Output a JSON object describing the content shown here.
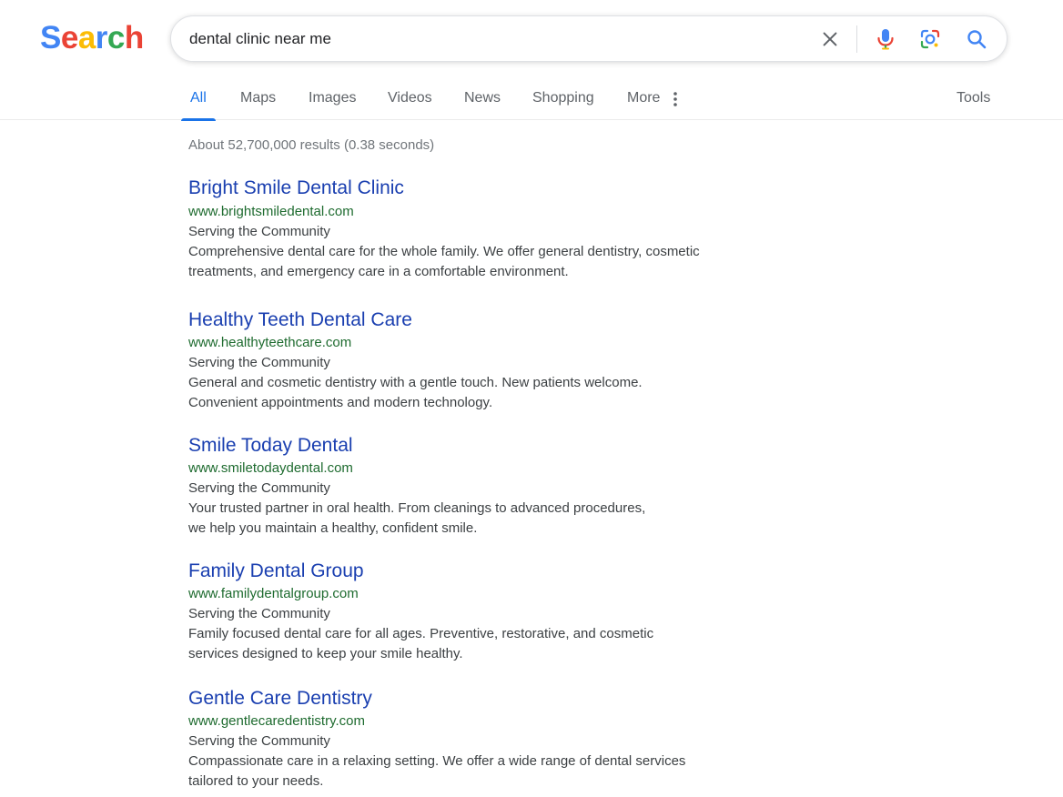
{
  "logo": {
    "letters": [
      {
        "char": "S",
        "color": "#4285F4"
      },
      {
        "char": "e",
        "color": "#EA4335"
      },
      {
        "char": "a",
        "color": "#FBBC05"
      },
      {
        "char": "r",
        "color": "#4285F4"
      },
      {
        "char": "c",
        "color": "#34A853"
      },
      {
        "char": "h",
        "color": "#EA4335"
      }
    ]
  },
  "search": {
    "query": "dental clinic near me",
    "icons": [
      "close-icon",
      "microphone-icon",
      "lens-icon",
      "magnify-icon"
    ]
  },
  "tabs": [
    {
      "label": "All",
      "active": true
    },
    {
      "label": "Maps"
    },
    {
      "label": "Images"
    },
    {
      "label": "Videos"
    },
    {
      "label": "News"
    },
    {
      "label": "Shopping"
    },
    {
      "label": "More"
    }
  ],
  "tools_label": "Tools",
  "result_stats": "About 52,700,000 results (0.38 seconds)",
  "results": [
    {
      "title": "Bright Smile Dental Clinic",
      "url": "www.brightsmiledental.com",
      "tag": "Serving the Community",
      "snippet_lines": [
        "Comprehensive dental care for the whole family. We offer general dentistry, cosmetic",
        "treatments, and emergency care in a comfortable environment."
      ]
    },
    {
      "title": "Healthy Teeth Dental Care",
      "url": "www.healthyteethcare.com",
      "tag": "Serving the Community",
      "snippet_lines": [
        "General and cosmetic dentistry with a gentle touch. New patients welcome.",
        "Convenient appointments and modern technology."
      ]
    },
    {
      "title": "Smile Today Dental",
      "url": "www.smiletodaydental.com",
      "tag": "Serving the Community",
      "snippet_lines": [
        "Your trusted partner in oral health. From cleanings to advanced procedures,",
        "we help you maintain a healthy, confident smile."
      ]
    },
    {
      "title": "Family Dental Group",
      "url": "www.familydentalgroup.com",
      "tag": "Serving the Community",
      "snippet_lines": [
        "Family focused dental care for all ages. Preventive, restorative, and cosmetic",
        "services designed to keep your smile healthy."
      ]
    },
    {
      "title": "Gentle Care Dentistry",
      "url": "www.gentlecaredentistry.com",
      "tag": "Serving the Community",
      "snippet_lines": [
        "Compassionate care in a relaxing setting. We offer a wide range of dental services",
        "tailored to your needs."
      ]
    }
  ],
  "colors": {
    "accent": "#1a73e8",
    "link": "#1a3fb0",
    "url": "#1e6b2f"
  }
}
